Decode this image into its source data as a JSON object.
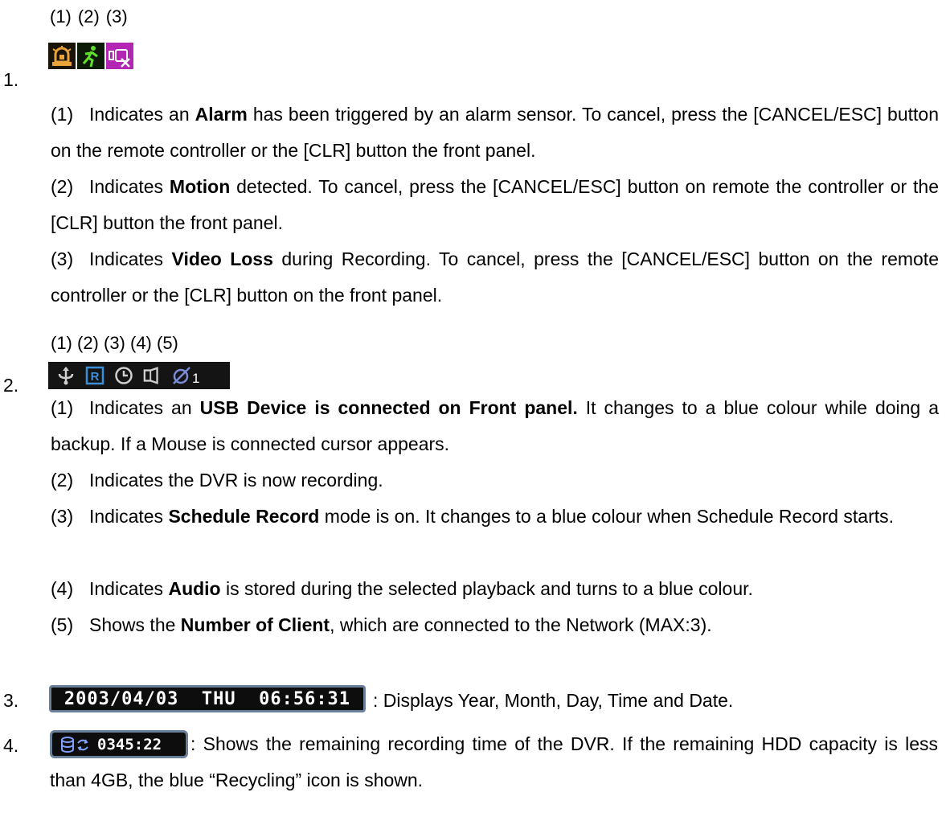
{
  "section1": {
    "number": "1.",
    "icon_labels": [
      "(1)",
      "(2)",
      "(3)"
    ],
    "icons": [
      "alarm-bell-icon",
      "running-man-icon",
      "video-loss-icon"
    ],
    "items": [
      {
        "label": "(1)",
        "pre": "Indicates an ",
        "bold": "Alarm",
        "post": " has been triggered by an alarm sensor. To cancel, press the [CANCEL/ESC] button on the remote controller or the [CLR] button the front panel."
      },
      {
        "label": "(2)",
        "pre": "Indicates ",
        "bold": "Motion",
        "post": " detected. To cancel, press the [CANCEL/ESC] button on remote the controller or the [CLR] button the front panel."
      },
      {
        "label": "(3)",
        "pre": "Indicates ",
        "bold": "Video Loss",
        "post": " during Recording. To cancel, press the [CANCEL/ESC] button on the remote controller or the [CLR] button on the front panel."
      }
    ]
  },
  "section2": {
    "number": "2.",
    "icon_labels": "(1) (2) (3) (4) (5)",
    "icons": [
      "usb-icon",
      "record-icon",
      "clock-icon",
      "audio-icon",
      "network-icon"
    ],
    "client_count": "1",
    "items": [
      {
        "label": "(1)",
        "pre": "Indicates an ",
        "bold": "USB Device is connected on Front panel.",
        "post": " It changes to a blue colour while doing a backup. If a Mouse is connected cursor appears."
      },
      {
        "label": "(2)",
        "pre": "Indicates the DVR is now recording.",
        "bold": "",
        "post": ""
      },
      {
        "label": "(3)",
        "pre": "Indicates ",
        "bold": "Schedule Record",
        "post": " mode is on. It changes to a blue colour when Schedule Record starts."
      },
      {
        "label": "(4)",
        "pre": "Indicates ",
        "bold": "Audio",
        "post": " is stored during the selected playback and turns to a blue colour."
      },
      {
        "label": "(5)",
        "pre": "Shows the ",
        "bold": "Number of Client",
        "post": ", which are connected to the Network (MAX:3)."
      }
    ]
  },
  "section3": {
    "number": "3.",
    "datetime": "2003/04/03  THU  06:56:31",
    "desc": ": Displays Year, Month, Day, Time and Date."
  },
  "section4": {
    "number": "4.",
    "time": "0345:22",
    "desc": ": Shows the remaining recording time of the DVR. If the remaining HDD capacity is less than 4GB, the blue “Recycling” icon is shown."
  }
}
